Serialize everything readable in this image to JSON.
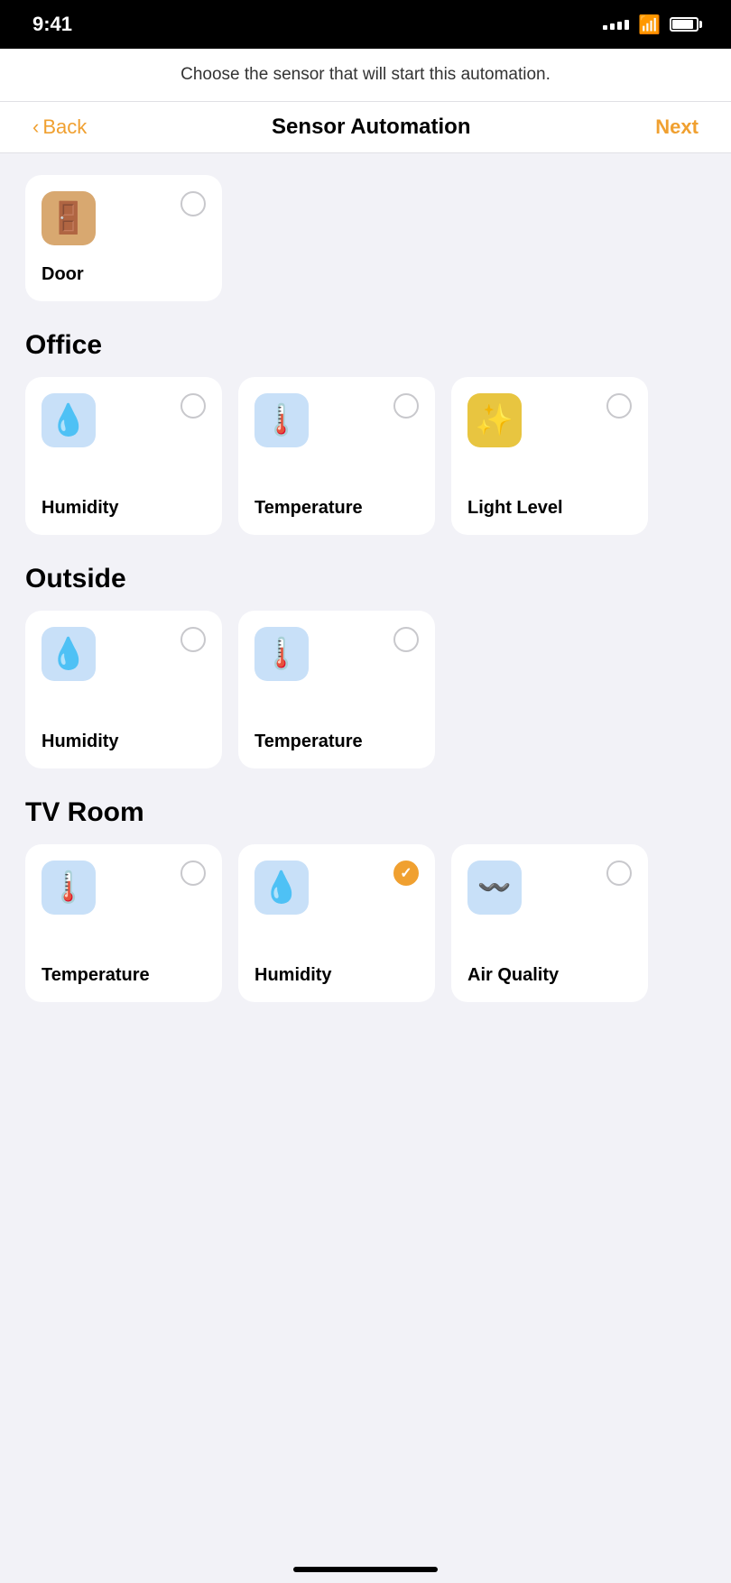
{
  "statusBar": {
    "time": "9:41",
    "signalBars": [
      3,
      5,
      7,
      9,
      11
    ],
    "battery": 90
  },
  "subtitle": "Choose the sensor that will start this automation.",
  "nav": {
    "back": "Back",
    "title": "Sensor Automation",
    "next": "Next"
  },
  "sections": [
    {
      "id": "top-partial",
      "showTitle": false,
      "cards": [
        {
          "id": "door",
          "label": "Door",
          "icon": "🚪",
          "iconBg": "icon-orange-door",
          "checked": false,
          "partial": true
        }
      ]
    },
    {
      "id": "office",
      "title": "Office",
      "cards": [
        {
          "id": "office-humidity",
          "label": "Humidity",
          "icon": "💧",
          "iconBg": "icon-blue",
          "checked": false
        },
        {
          "id": "office-temperature",
          "label": "Temperature",
          "icon": "🌡️",
          "iconBg": "icon-blue",
          "checked": false
        },
        {
          "id": "office-light",
          "label": "Light Level",
          "icon": "✨",
          "iconBg": "icon-gold",
          "checked": false
        }
      ]
    },
    {
      "id": "outside",
      "title": "Outside",
      "cards": [
        {
          "id": "outside-humidity",
          "label": "Humidity",
          "icon": "💧",
          "iconBg": "icon-blue",
          "checked": false
        },
        {
          "id": "outside-temperature",
          "label": "Temperature",
          "icon": "🌡️",
          "iconBg": "icon-blue",
          "checked": false
        }
      ]
    },
    {
      "id": "tvroom",
      "title": "TV Room",
      "cards": [
        {
          "id": "tvroom-temperature",
          "label": "Temperature",
          "icon": "🌡️",
          "iconBg": "icon-blue",
          "checked": false
        },
        {
          "id": "tvroom-humidity",
          "label": "Humidity",
          "icon": "💧",
          "iconBg": "icon-blue",
          "checked": true
        },
        {
          "id": "tvroom-airquality",
          "label": "Air Quality",
          "icon": "💨",
          "iconBg": "icon-blue",
          "checked": false
        }
      ]
    }
  ]
}
